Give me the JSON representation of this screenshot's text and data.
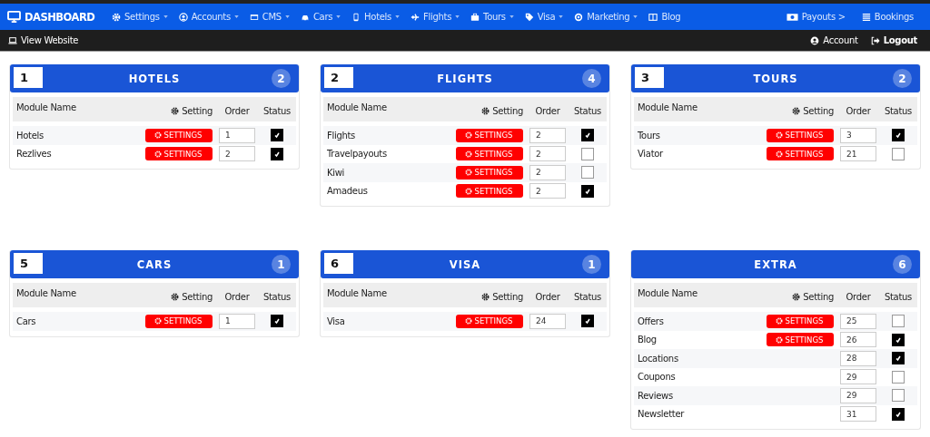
{
  "topnav": {
    "brand": "DASHBOARD",
    "items": [
      {
        "label": "Settings",
        "dropdown": true
      },
      {
        "label": "Accounts",
        "dropdown": true
      },
      {
        "label": "CMS",
        "dropdown": true
      },
      {
        "label": "Cars",
        "dropdown": true
      },
      {
        "label": "Hotels",
        "dropdown": true
      },
      {
        "label": "Flights",
        "dropdown": true
      },
      {
        "label": "Tours",
        "dropdown": true
      },
      {
        "label": "Visa",
        "dropdown": true
      },
      {
        "label": "Marketing",
        "dropdown": true
      },
      {
        "label": "Blog",
        "dropdown": false
      }
    ],
    "right_items": [
      {
        "label": "Payouts >"
      },
      {
        "label": "Bookings"
      }
    ]
  },
  "subbar": {
    "view_website": "View Website",
    "account": "Account",
    "logout": "Logout"
  },
  "panels": [
    {
      "number": "1",
      "title": "HOTELS",
      "count": "2",
      "columns": [
        "Module Name",
        "Setting",
        "Order",
        "Status"
      ],
      "rows": [
        {
          "name": "Hotels",
          "settings": "SETTINGS",
          "order": "1",
          "checked": true
        },
        {
          "name": "Rezlives",
          "settings": "SETTINGS",
          "order": "2",
          "checked": true
        }
      ]
    },
    {
      "number": "2",
      "title": "FLIGHTS",
      "count": "4",
      "columns": [
        "Module Name",
        "Setting",
        "Order",
        "Status"
      ],
      "rows": [
        {
          "name": "Flights",
          "settings": "SETTINGS",
          "order": "2",
          "checked": true
        },
        {
          "name": "Travelpayouts",
          "settings": "SETTINGS",
          "order": "2",
          "checked": false
        },
        {
          "name": "Kiwi",
          "settings": "SETTINGS",
          "order": "2",
          "checked": false
        },
        {
          "name": "Amadeus",
          "settings": "SETTINGS",
          "order": "2",
          "checked": true
        }
      ]
    },
    {
      "number": "3",
      "title": "TOURS",
      "count": "2",
      "columns": [
        "Module Name",
        "Setting",
        "Order",
        "Status"
      ],
      "rows": [
        {
          "name": "Tours",
          "settings": "SETTINGS",
          "order": "3",
          "checked": true
        },
        {
          "name": "Viator",
          "settings": "SETTINGS",
          "order": "21",
          "checked": false
        }
      ]
    },
    {
      "number": "5",
      "title": "CARS",
      "count": "1",
      "columns": [
        "Module Name",
        "Setting",
        "Order",
        "Status"
      ],
      "rows": [
        {
          "name": "Cars",
          "settings": "SETTINGS",
          "order": "1",
          "checked": true
        }
      ]
    },
    {
      "number": "6",
      "title": "VISA",
      "count": "1",
      "columns": [
        "Module Name",
        "Setting",
        "Order",
        "Status"
      ],
      "rows": [
        {
          "name": "Visa",
          "settings": "SETTINGS",
          "order": "24",
          "checked": true
        }
      ]
    },
    {
      "title": "EXTRA",
      "count": "6",
      "columns": [
        "Module Name",
        "Setting",
        "Order",
        "Status"
      ],
      "rows": [
        {
          "name": "Offers",
          "settings": "SETTINGS",
          "order": "25",
          "checked": false
        },
        {
          "name": "Blog",
          "settings": "SETTINGS",
          "order": "26",
          "checked": true
        },
        {
          "name": "Locations",
          "order": "28",
          "checked": true
        },
        {
          "name": "Coupons",
          "order": "29",
          "checked": false
        },
        {
          "name": "Reviews",
          "order": "29",
          "checked": false
        },
        {
          "name": "Newsletter",
          "order": "31",
          "checked": true
        }
      ]
    }
  ]
}
